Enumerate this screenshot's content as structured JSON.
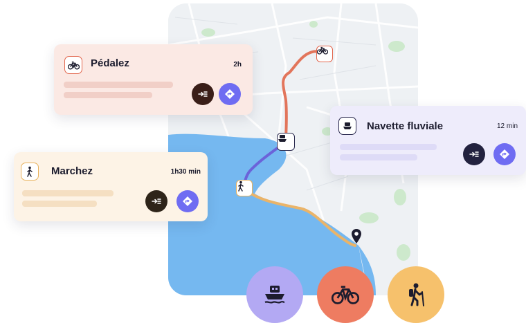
{
  "cards": {
    "velo": {
      "title": "Pédalez",
      "duration": "2h"
    },
    "navette": {
      "title": "Navette fluviale",
      "duration": "12 min"
    },
    "marche": {
      "title": "Marchez",
      "duration": "1h30 min"
    }
  },
  "icons": {
    "bike": "bike-icon",
    "boat": "boat-icon",
    "walk": "walk-icon",
    "hike": "hiker-icon",
    "start_nav": "start-navigation-icon",
    "directions": "directions-icon",
    "pin": "map-pin-icon"
  },
  "colors": {
    "velo_card": "#fbe9e4",
    "velo_accent": "#e2664d",
    "navette_card": "#eeecfb",
    "navette_accent": "#2b2a4f",
    "marche_card": "#fdf3e6",
    "marche_accent": "#e8b25d",
    "directions_button": "#6f6cf2",
    "start_button": "#3a1e18",
    "bike_route": "#e2755b",
    "boat_route": "#6b63d9",
    "walk_route": "#eab469",
    "water": "#75b8f0",
    "boat_circle": "#b3a9f3",
    "bike_circle": "#ee7c61",
    "hike_circle": "#f6c16c"
  }
}
